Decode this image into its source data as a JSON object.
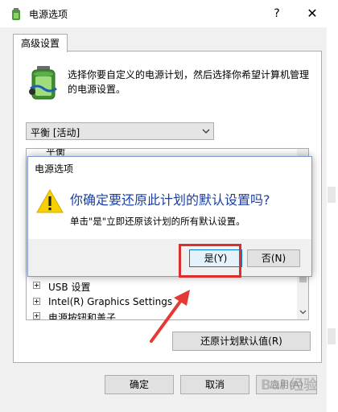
{
  "window": {
    "title": "电源选项",
    "help_glyph": "?",
    "close_glyph": "✕"
  },
  "tabs": [
    {
      "label": "高级设置"
    }
  ],
  "panel": {
    "description": "选择你要自定义的电源计划，然后选择你希望计算机管理的电源设置。",
    "plan_select": {
      "value": "平衡 [活动]"
    },
    "tree": {
      "top_partial": "平衡",
      "items": [
        {
          "label": "USB 设置"
        },
        {
          "label": "Intel(R) Graphics Settings"
        },
        {
          "label": "电源按钮和盖子"
        }
      ]
    },
    "restore_button": "还原计划默认值(R)"
  },
  "footer": {
    "ok": "确定",
    "cancel": "取消",
    "apply": "应用(A)"
  },
  "dialog": {
    "title": "电源选项",
    "question": "你确定要还原此计划的默认设置吗?",
    "detail": "单击\"是\"立即还原该计划的所有默认设置。",
    "yes": "是(Y)",
    "no": "否(N)"
  },
  "annotation": {
    "highlight_color": "#d9302e"
  },
  "watermark": "Bai 经验",
  "colors": {
    "dialog_text": "#1b3fa0",
    "focus_border": "#0078d7"
  }
}
